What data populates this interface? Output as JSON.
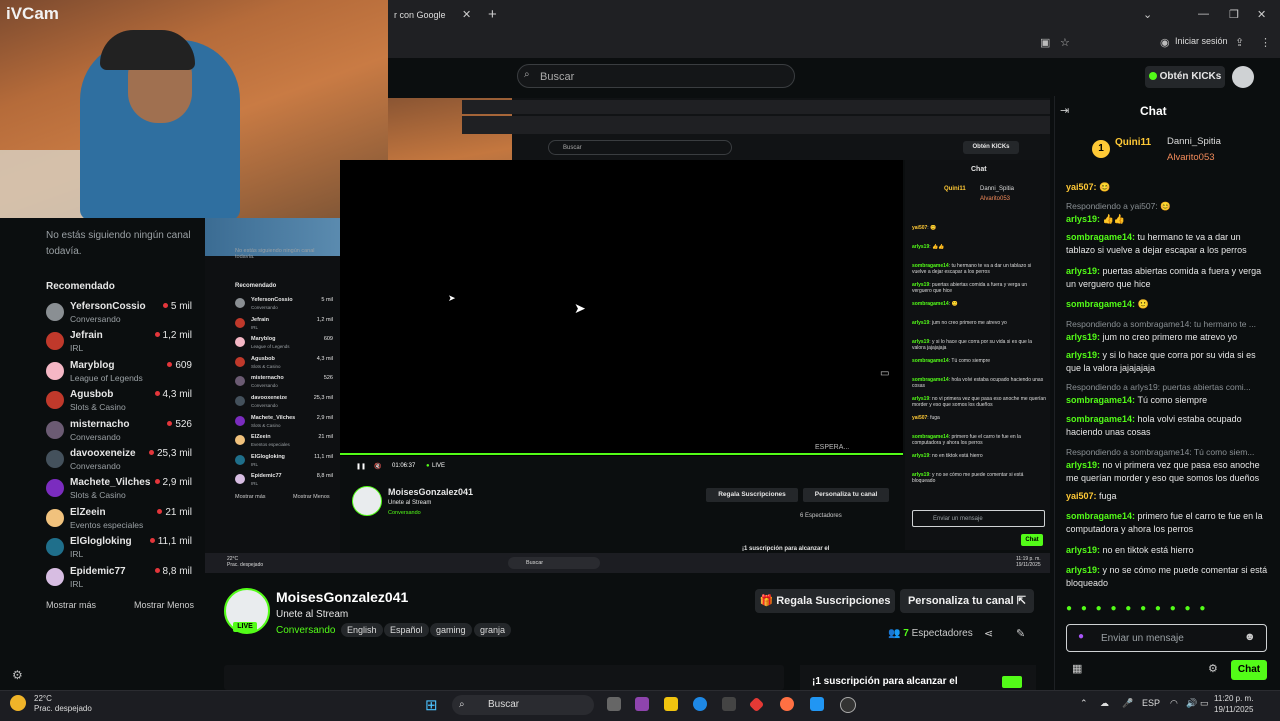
{
  "camera": {
    "label": "iVCam"
  },
  "browser": {
    "tab_title": "r con Google",
    "signin_label": "Iniciar sesión"
  },
  "header": {
    "search_placeholder": "Buscar",
    "kicks_label": "Obtén KICKs"
  },
  "sidebar": {
    "follow_note": "No estás siguiendo ningún canal todavía.",
    "recommended_title": "Recomendado",
    "channels": [
      {
        "name": "YefersonCossio",
        "category": "Conversando",
        "viewers": "5 mil",
        "color": "#8a8f93"
      },
      {
        "name": "Jefrain",
        "category": "IRL",
        "viewers": "1,2 mil",
        "color": "#c0392b"
      },
      {
        "name": "Maryblog",
        "category": "League of Legends",
        "viewers": "609",
        "color": "#f5b7c5"
      },
      {
        "name": "Agusbob",
        "category": "Slots & Casino",
        "viewers": "4,3 mil",
        "color": "#c0392b"
      },
      {
        "name": "misternacho",
        "category": "Conversando",
        "viewers": "526",
        "color": "#6b5b73"
      },
      {
        "name": "davooxeneize",
        "category": "Conversando",
        "viewers": "25,3 mil",
        "color": "#44515c"
      },
      {
        "name": "Machete_Vilches",
        "category": "Slots & Casino",
        "viewers": "2,9 mil",
        "color": "#7b2cbf"
      },
      {
        "name": "ElZeein",
        "category": "Eventos especiales",
        "viewers": "21 mil",
        "color": "#f1c27d"
      },
      {
        "name": "ElGlogloking",
        "category": "IRL",
        "viewers": "11,1 mil",
        "color": "#1f6f8b"
      },
      {
        "name": "Epidemic77",
        "category": "IRL",
        "viewers": "8,8 mil",
        "color": "#d7bde2"
      }
    ],
    "show_more": "Mostrar más",
    "show_less": "Mostrar Menos"
  },
  "nested": {
    "time": "01:06:37",
    "live": "LIVE",
    "espera": "ESPERA...",
    "chat_title": "Chat",
    "name": "MoisesGonzalez041",
    "title": "Unete al Stream",
    "viewers": "6 Espectadores",
    "subs_btn": "Regala Suscripciones",
    "persona_btn": "Personaliza tu canal",
    "input_placeholder": "Enviar un mensaje",
    "chat_btn": "Chat",
    "sub_goal": "¡1 suscripción para alcanzar el",
    "taskbar_search": "Buscar",
    "weather": "22°C",
    "weather_desc": "Prac. despejado",
    "clock_time": "11:19 p. m.",
    "clock_date": "19/11/2025"
  },
  "stream": {
    "streamer_name": "MoisesGonzalez041",
    "title": "Unete al Stream",
    "category": "Conversando",
    "tags": [
      "English",
      "Español",
      "gaming",
      "granja"
    ],
    "live_badge": "LIVE",
    "subs_button": "Regala Suscripciones",
    "persona_button": "Personaliza tu canal",
    "viewers_count": "7",
    "viewers_label": "Espectadores",
    "sub_goal": "¡1 suscripción para alcanzar el"
  },
  "chat": {
    "title": "Chat",
    "leaders": {
      "first": "Quini11",
      "second": "Danni_Spitia",
      "third": "Alvarito053"
    },
    "messages": [
      {
        "user": "yai507",
        "text": "😊",
        "reply": "",
        "color": "gold"
      },
      {
        "user": "arlys19",
        "text": "👍👍",
        "reply": "Respondiendo a yai507: 😊",
        "color": "green"
      },
      {
        "user": "sombragame14",
        "text": "tu hermano te va a dar un tablazo si vuelve a dejar escapar a los perros",
        "reply": "",
        "color": "green"
      },
      {
        "user": "arlys19",
        "text": "puertas abiertas comida a fuera y verga un verguero que hice",
        "reply": "",
        "color": "green"
      },
      {
        "user": "sombragame14",
        "text": "🙂",
        "reply": "",
        "color": "green"
      },
      {
        "user": "arlys19",
        "text": "jum no creo primero me atrevo yo",
        "reply": "Respondiendo a sombragame14: tu hermano te ...",
        "color": "green"
      },
      {
        "user": "arlys19",
        "text": "y si lo hace que corra por su vida si es que la valora jajajajaja",
        "reply": "",
        "color": "green"
      },
      {
        "user": "sombragame14",
        "text": "Tú como siempre",
        "reply": "Respondiendo a arlys19: puertas abiertas comi...",
        "color": "green"
      },
      {
        "user": "sombragame14",
        "text": "hola volvi estaba ocupado haciendo unas cosas",
        "reply": "",
        "color": "green"
      },
      {
        "user": "arlys19",
        "text": "no vi primera vez que pasa eso anoche me querían morder y eso que somos los dueños",
        "reply": "Respondiendo a sombragame14: Tú como siem...",
        "color": "green"
      },
      {
        "user": "yai507",
        "text": "fuga",
        "reply": "",
        "color": "gold"
      },
      {
        "user": "sombragame14",
        "text": "primero fue el carro te fue en la computadora y ahora los perros",
        "reply": "",
        "color": "green"
      },
      {
        "user": "arlys19",
        "text": "no en tiktok está hierro",
        "reply": "",
        "color": "green"
      },
      {
        "user": "arlys19",
        "text": "y no se cómo me puede comentar si está bloqueado",
        "reply": "",
        "color": "green"
      }
    ],
    "input_placeholder": "Enviar un mensaje",
    "send_label": "Chat"
  },
  "taskbar": {
    "weather_temp": "22°C",
    "weather_desc": "Prac. despejado",
    "search_label": "Buscar",
    "lang": "ESP",
    "time": "11:20 p. m.",
    "date": "19/11/2025"
  },
  "colors": {
    "accent": "#53fc18",
    "bg": "#0b0e0f",
    "panel": "#24272a"
  }
}
